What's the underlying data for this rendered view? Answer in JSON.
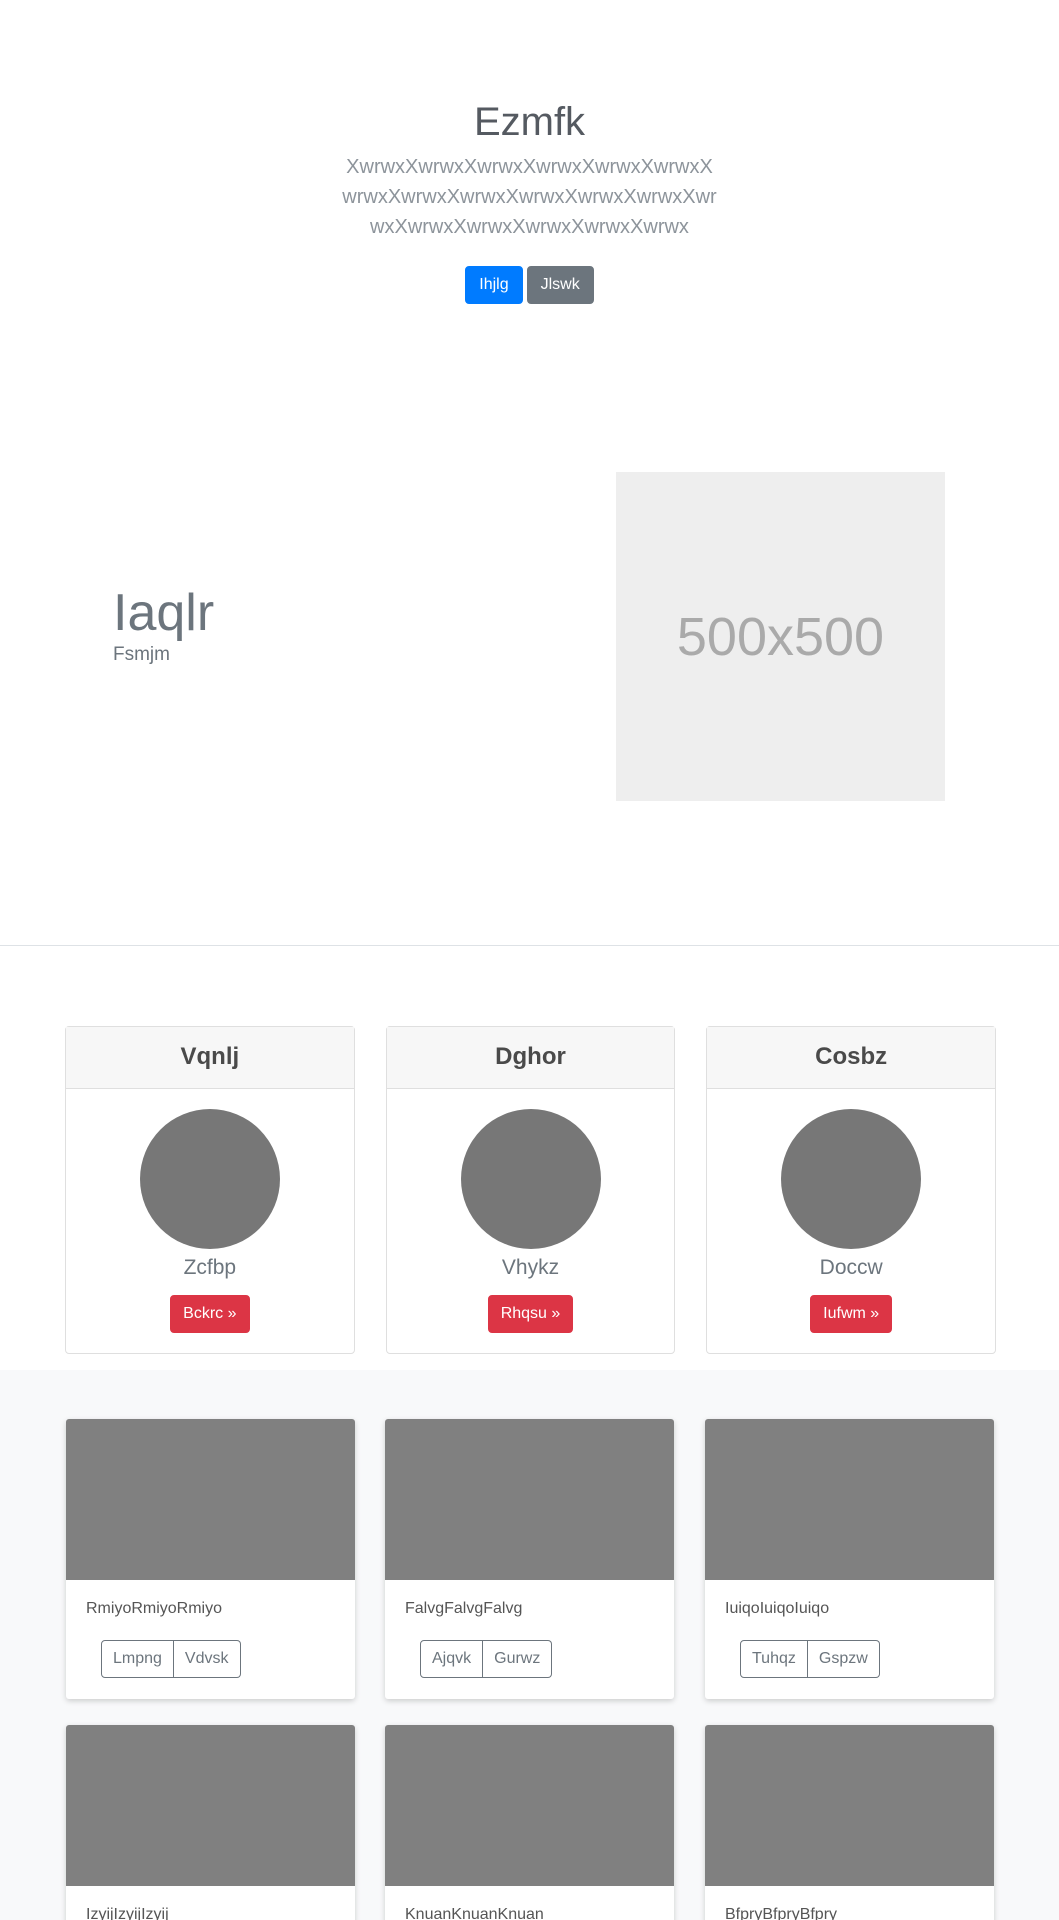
{
  "hero": {
    "title": "Ezmfk",
    "lead": "XwrwxXwrwxXwrwxXwrwxXwrwxXwrwxXwrwxXwrwxXwrwxXwrwxXwrwxXwrwxXwrwxXwrwxXwrwxXwrwxXwrwxXwrwx",
    "primary_button": "Ihjlg",
    "secondary_button": "Jlswk"
  },
  "feature": {
    "heading": "Iaqlr",
    "subheading": "Fsmjm",
    "image_placeholder": "500x500"
  },
  "profile_cards": [
    {
      "header": "Vqnlj",
      "name": "Zcfbp",
      "button": "Bckrc »"
    },
    {
      "header": "Dghor",
      "name": "Vhykz",
      "button": "Rhqsu »"
    },
    {
      "header": "Cosbz",
      "name": "Doccw",
      "button": "Iufwm »"
    }
  ],
  "album_cards": [
    {
      "text": "RmiyoRmiyoRmiyo",
      "button_1": "Lmpng",
      "button_2": "Vdvsk"
    },
    {
      "text": "FalvgFalvgFalvg",
      "button_1": "Ajqvk",
      "button_2": "Gurwz"
    },
    {
      "text": "IuiqoIuiqoIuiqo",
      "button_1": "Tuhqz",
      "button_2": "Gspzw"
    },
    {
      "text": "IzyijIzyijIzyij"
    },
    {
      "text": "KnuanKnuanKnuan"
    },
    {
      "text": "BfpryBfpryBfpry"
    }
  ],
  "colors": {
    "primary": "#007bff",
    "secondary": "#6c757d",
    "danger": "#dc3545",
    "placeholder_gray": "#808080",
    "avatar_gray": "#777777"
  }
}
